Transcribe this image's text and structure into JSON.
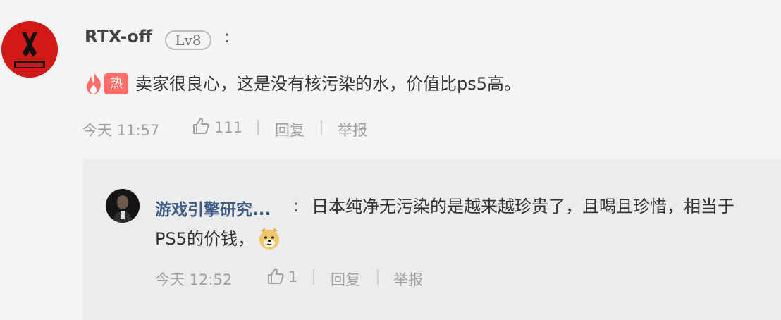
{
  "main_comment": {
    "username": "RTX-off",
    "level": "Lv8",
    "colon": ":",
    "hot_label": "热",
    "text": "卖家很良心，这是没有核污染的水，价值比ps5高。",
    "time": "今天 11:57",
    "likes": "111",
    "reply_label": "回复",
    "report_label": "举报"
  },
  "reply_comment": {
    "username": "游戏引擎研究...",
    "colon": ":",
    "text_line1": "日本纯净无污染的是越来越珍贵了，且喝且珍惜，相当于",
    "text_line2": "PS5的价钱，",
    "time": "今天 12:52",
    "likes": "1",
    "reply_label": "回复",
    "report_label": "举报"
  }
}
